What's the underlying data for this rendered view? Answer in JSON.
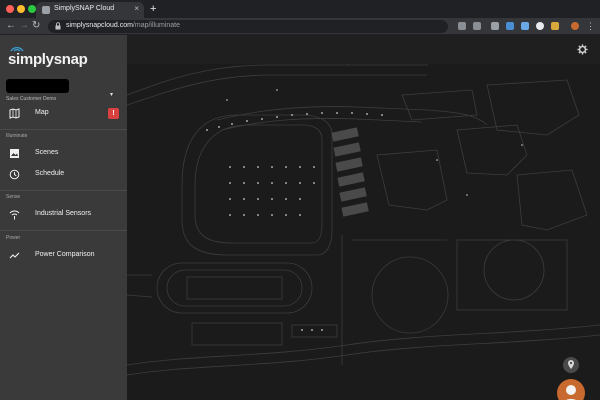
{
  "browser": {
    "tab_title": "SimplySNAP Cloud",
    "tab_close": "×",
    "new_tab": "+",
    "url_host": "simplysnapcloud.com",
    "url_path": "/map/illuminate",
    "back": "←",
    "forward": "→",
    "reload": "↻"
  },
  "colors": {
    "close": "#ff5f57",
    "minimize": "#febc2e",
    "maximize": "#28c840",
    "accent": "#d94040",
    "avatar": "#c86a2f"
  },
  "sidebar": {
    "logo": "simplysnap",
    "account": "Sales Customer Demo",
    "account_caret": "▾",
    "sections": [
      {
        "label": "",
        "items": [
          {
            "label": "Map",
            "icon": "map-icon",
            "badge": "!"
          }
        ]
      },
      {
        "label": "Illuminate",
        "items": [
          {
            "label": "Scenes",
            "icon": "image-icon"
          },
          {
            "label": "Schedule",
            "icon": "clock-icon"
          }
        ]
      },
      {
        "label": "Sense",
        "items": [
          {
            "label": "Industrial Sensors",
            "icon": "wifi-icon"
          }
        ]
      },
      {
        "label": "Power",
        "items": [
          {
            "label": "Power Comparison",
            "icon": "trend-icon"
          }
        ]
      }
    ]
  },
  "map": {
    "settings_icon": "gear-icon",
    "fab_icon": "location-pin-icon",
    "avatar_icon": "user-avatar-icon"
  }
}
